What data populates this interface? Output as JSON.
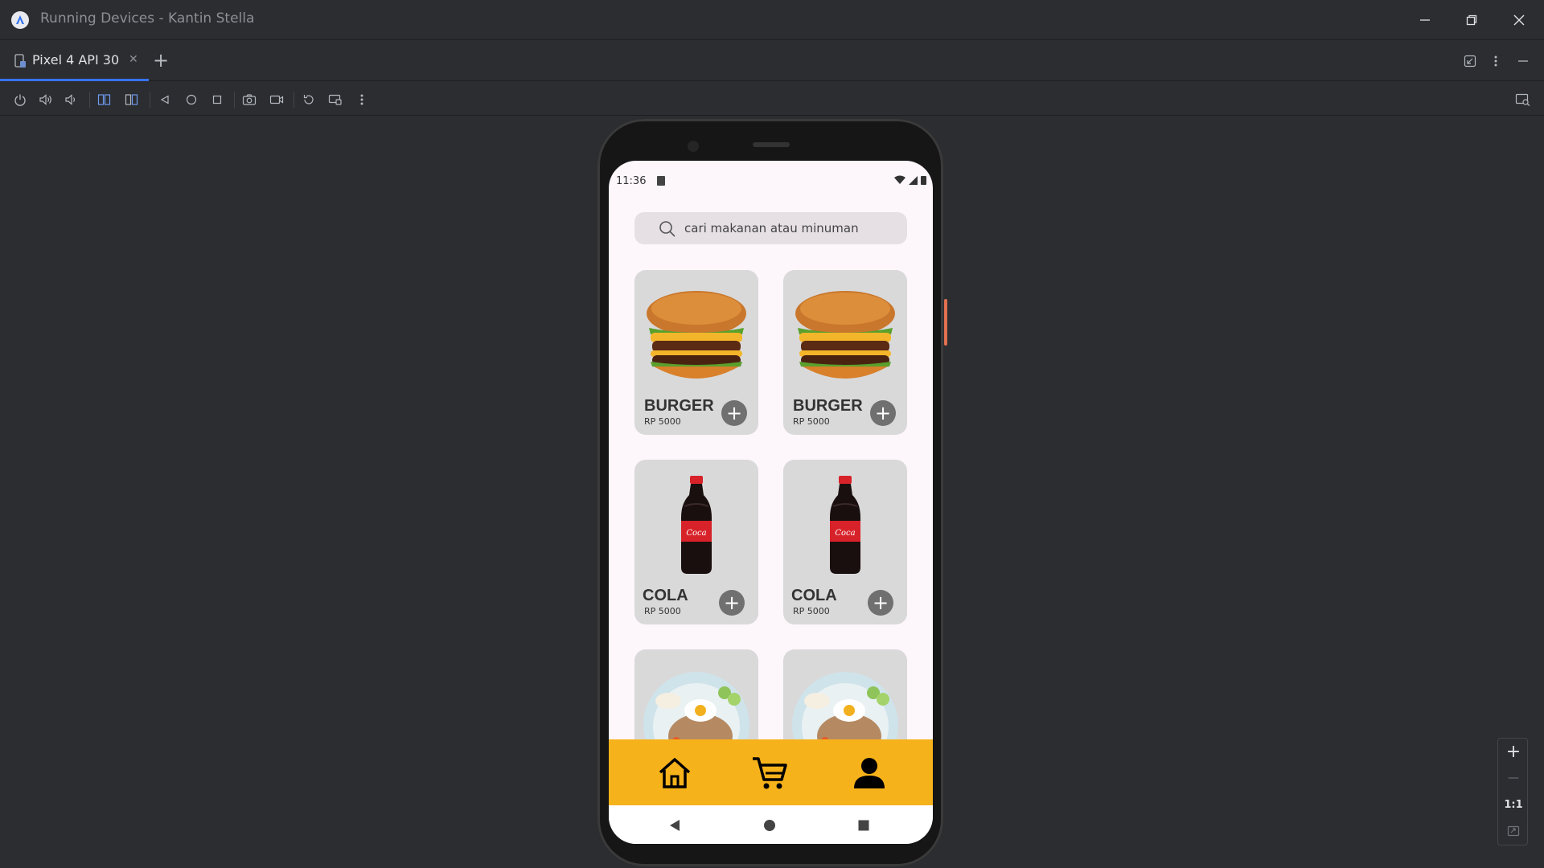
{
  "window": {
    "title": "Running Devices - Kantin Stella",
    "controls": [
      "minimize-icon",
      "restore-icon",
      "close-icon"
    ]
  },
  "tabs": [
    {
      "label": "Pixel 4 API 30",
      "active": true,
      "icon": "device-phone-icon"
    }
  ],
  "tabbar_actions": [
    "add-tab-icon",
    "collapse-icon",
    "more-vertical-icon",
    "minimize-panel-icon"
  ],
  "toolbar": {
    "buttons": [
      "power-icon",
      "volume-up-icon",
      "volume-down-icon",
      "rotate-left-icon",
      "rotate-right-icon",
      "back-icon",
      "home-icon",
      "overview-icon",
      "screenshot-icon",
      "screen-record-icon",
      "snapshot-icon",
      "device-mirror-icon",
      "more-vertical-icon"
    ],
    "right": "layout-inspector-icon"
  },
  "device": {
    "status": {
      "time": "11:36"
    },
    "search": {
      "placeholder": "cari makanan atau minuman"
    },
    "products": [
      {
        "name": "BURGER",
        "price": "RP 5000",
        "image": "burger"
      },
      {
        "name": "BURGER",
        "price": "RP 5000",
        "image": "burger"
      },
      {
        "name": "COLA",
        "price": "RP 5000",
        "image": "cola"
      },
      {
        "name": "COLA",
        "price": "RP 5000",
        "image": "cola"
      },
      {
        "name": "",
        "price": "",
        "image": "fried-rice"
      },
      {
        "name": "",
        "price": "",
        "image": "fried-rice"
      }
    ],
    "add_symbol": "+",
    "bottom_nav": [
      "home-icon",
      "cart-icon",
      "profile-icon"
    ],
    "system_nav": [
      "back-icon",
      "home-icon",
      "recents-icon"
    ],
    "colors": {
      "nav_bar": "#f6b21a",
      "card": "#d9d9d9",
      "screen_bg": "#fdf6fb"
    }
  },
  "zoom": {
    "zoom_in": "+",
    "zoom_out": "—",
    "ratio": "1:1",
    "fit": "fit-screen-icon"
  }
}
